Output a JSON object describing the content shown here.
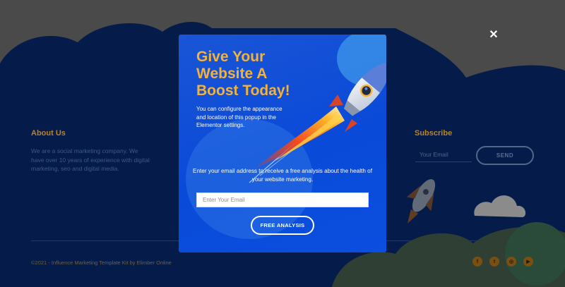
{
  "footer": {
    "about_title": "About Us",
    "about_text": "We are a social marketing company. We have over 10 years of experience with digital marketing, seo and digital media.",
    "subscribe_title": "Subscribe",
    "subscribe_placeholder": "Your Email",
    "send_label": "SEND",
    "copyright": "©2021 - Influence Marketing Template Kit by Elimber Online",
    "social_icons": [
      "facebook-icon",
      "twitter-icon",
      "instagram-icon",
      "youtube-icon"
    ],
    "social_glyphs": [
      "f",
      "t",
      "◎",
      "▶"
    ]
  },
  "popup": {
    "headline": "Give Your Website A Boost Today!",
    "description": "You can configure the appearance and location of this popup in the Elementor settings.",
    "prompt": "Enter your email address to receive a free analysis about the health of your website marketing.",
    "email_placeholder": "Enter Your Email",
    "button_label": "FREE ANALYSIS",
    "close_glyph": "✕"
  },
  "colors": {
    "overlay": "#4a4a4a",
    "popup_bg": "#0a4ad8",
    "headline": "#f3b23a",
    "button_border": "#ffffff"
  }
}
